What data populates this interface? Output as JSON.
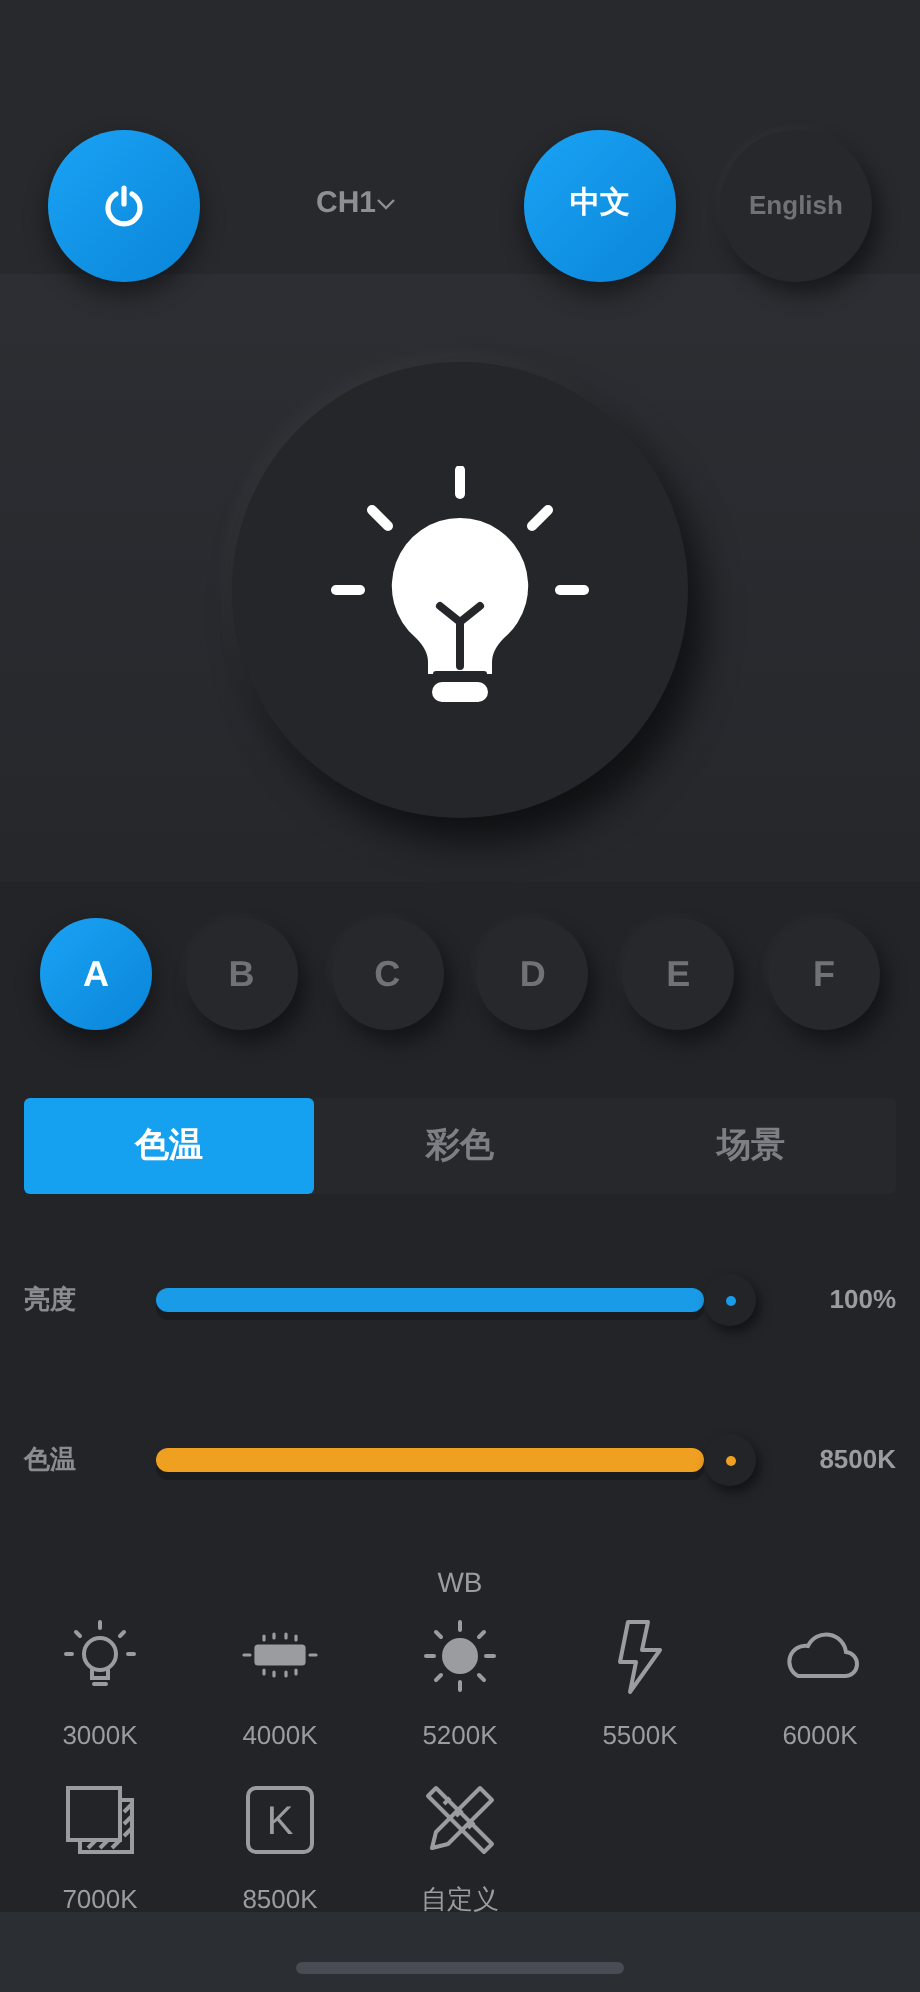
{
  "header": {
    "power_on": true,
    "channel": "CH1",
    "languages": [
      {
        "label": "中文",
        "selected": true
      },
      {
        "label": "English",
        "selected": false
      }
    ]
  },
  "lamp": {
    "on": true
  },
  "channels": [
    {
      "label": "A",
      "selected": true
    },
    {
      "label": "B",
      "selected": false
    },
    {
      "label": "C",
      "selected": false
    },
    {
      "label": "D",
      "selected": false
    },
    {
      "label": "E",
      "selected": false
    },
    {
      "label": "F",
      "selected": false
    }
  ],
  "tabs": [
    {
      "label": "色温",
      "selected": true
    },
    {
      "label": "彩色",
      "selected": false
    },
    {
      "label": "场景",
      "selected": false
    }
  ],
  "sliders": [
    {
      "label": "亮度",
      "level": 1.0,
      "reading": "100%",
      "color": "#1a9be8"
    },
    {
      "label": "色温",
      "level": 1.0,
      "reading": "8500K",
      "color": "#f0a020"
    }
  ],
  "wb": {
    "title": "WB",
    "presets": [
      {
        "kind": "bulb",
        "label": "3000K"
      },
      {
        "kind": "tube",
        "label": "4000K"
      },
      {
        "kind": "sun",
        "label": "5200K"
      },
      {
        "kind": "flash",
        "label": "5500K"
      },
      {
        "kind": "cloud",
        "label": "6000K"
      },
      {
        "kind": "shade",
        "label": "7000K"
      },
      {
        "kind": "letter",
        "letter": "K",
        "label": "8500K"
      },
      {
        "kind": "tools",
        "label": "自定义"
      }
    ]
  }
}
